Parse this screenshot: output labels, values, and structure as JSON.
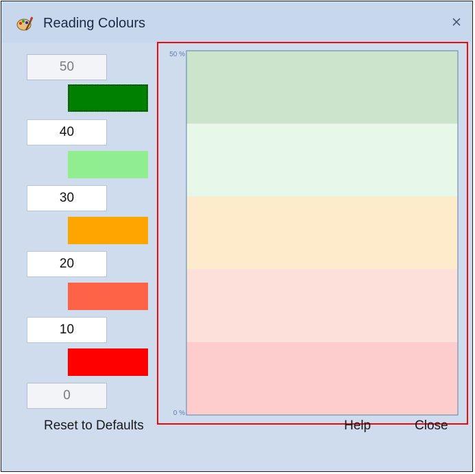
{
  "window": {
    "title": "Reading Colours",
    "close_icon": "close-icon"
  },
  "thresholds": [
    {
      "value": "50",
      "editable": false
    },
    {
      "value": "40",
      "editable": true
    },
    {
      "value": "30",
      "editable": true
    },
    {
      "value": "20",
      "editable": true
    },
    {
      "value": "10",
      "editable": true
    },
    {
      "value": "0",
      "editable": false
    }
  ],
  "swatches": [
    {
      "color": "#008000",
      "focused": true
    },
    {
      "color": "#90ee90",
      "focused": false
    },
    {
      "color": "#ffa500",
      "focused": false
    },
    {
      "color": "#ff6347",
      "focused": false
    },
    {
      "color": "#ff0000",
      "focused": false
    }
  ],
  "chart": {
    "y_max_label": "50 %",
    "y_min_label": "0 %",
    "bands": [
      {
        "from": 40,
        "to": 50,
        "color": "#cce3cc"
      },
      {
        "from": 30,
        "to": 40,
        "color": "#e8f8e8"
      },
      {
        "from": 20,
        "to": 30,
        "color": "#fdebcc"
      },
      {
        "from": 10,
        "to": 20,
        "color": "#fde0da"
      },
      {
        "from": 0,
        "to": 10,
        "color": "#fdcccc"
      }
    ]
  },
  "chart_data": {
    "type": "area",
    "title": "",
    "ylim": [
      0,
      50
    ],
    "ytick_labels": [
      "50 %",
      "0 %"
    ],
    "bands": [
      {
        "range": [
          40,
          50
        ],
        "color": "#cce3cc"
      },
      {
        "range": [
          30,
          40
        ],
        "color": "#e8f8e8"
      },
      {
        "range": [
          20,
          30
        ],
        "color": "#fdebcc"
      },
      {
        "range": [
          10,
          20
        ],
        "color": "#fde0da"
      },
      {
        "range": [
          0,
          10
        ],
        "color": "#fdcccc"
      }
    ]
  },
  "footer": {
    "reset_label": "Reset to Defaults",
    "help_label": "Help",
    "close_label": "Close"
  }
}
